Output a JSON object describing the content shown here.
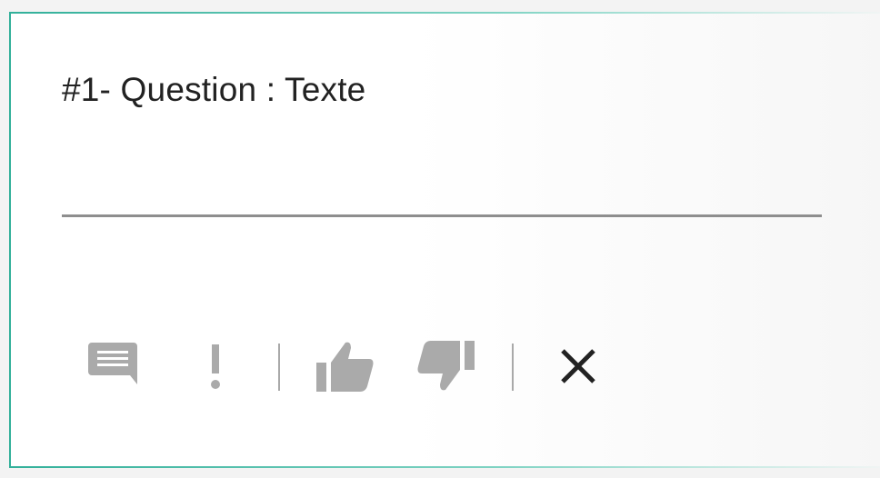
{
  "question": {
    "label": "#1- Question : Texte",
    "answer_value": ""
  },
  "toolbar": {
    "items": [
      {
        "icon": "comment-icon",
        "color": "#aaaaaa"
      },
      {
        "icon": "exclamation-icon",
        "color": "#aaaaaa"
      },
      {
        "icon": "thumbs-up-icon",
        "color": "#aaaaaa"
      },
      {
        "icon": "thumbs-down-icon",
        "color": "#aaaaaa"
      },
      {
        "icon": "close-icon",
        "color": "#222222"
      }
    ]
  },
  "colors": {
    "accent_border": "#32b09a",
    "icon_gray": "#aaaaaa",
    "text": "#222222"
  }
}
